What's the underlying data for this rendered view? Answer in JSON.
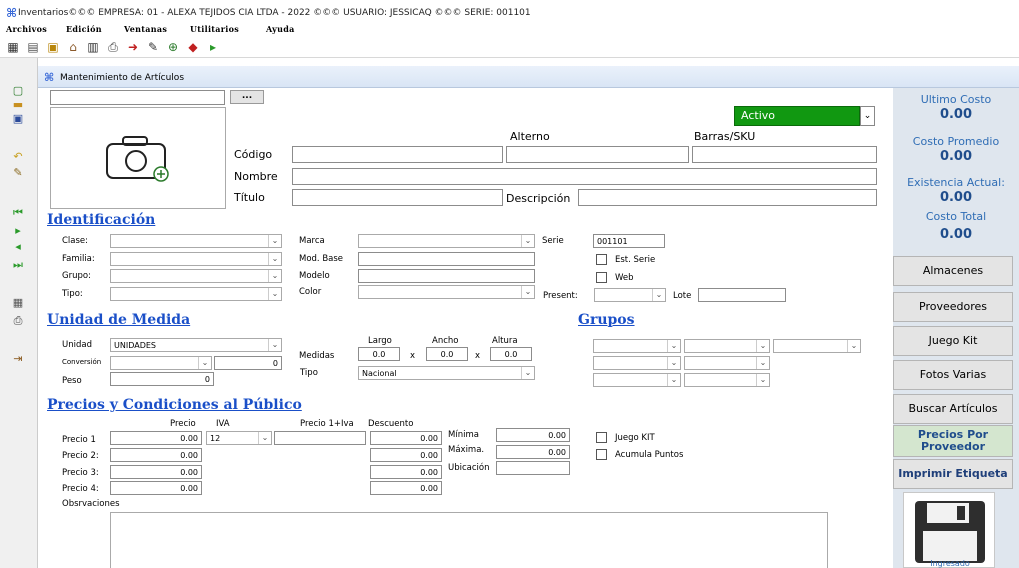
{
  "app": {
    "title": "Inventarios©©© EMPRESA: 01 - ALEXA TEJIDOS CIA LTDA - 2022 ©©©  USUARIO: JESSICAQ ©©© SERIE: 001101"
  },
  "menu": [
    "Archivos",
    "Edición",
    "Ventanas",
    "Utilitarios",
    "Ayuda"
  ],
  "window": {
    "title": "Mantenimiento de Artículos"
  },
  "header": {
    "ellipsis": "...",
    "status": "Activo",
    "alterno_label": "Alterno",
    "barras_label": "Barras/SKU",
    "codigo_label": "Código",
    "nombre_label": "Nombre",
    "titulo_label": "Título",
    "descripcion_label": "Descripción"
  },
  "identificacion": {
    "title": "Identificación",
    "clase": "Clase:",
    "familia": "Familia:",
    "grupo": "Grupo:",
    "tipo": "Tipo:",
    "marca": "Marca",
    "mod_base": "Mod. Base",
    "modelo": "Modelo",
    "color": "Color",
    "serie_label": "Serie",
    "serie_value": "001101",
    "est_serie": "Est. Serie",
    "web": "Web",
    "present": "Present:",
    "lote": "Lote"
  },
  "unidad": {
    "title": "Unidad de Medida",
    "unidad_label": "Unidad",
    "unidad_value": "UNIDADES",
    "conversion_label": "Conversión",
    "conversion_value": "0",
    "peso_label": "Peso",
    "peso_value": "0",
    "medidas_label": "Medidas",
    "largo": "Largo",
    "ancho": "Ancho",
    "altura": "Altura",
    "largo_value": "0.0",
    "ancho_value": "0.0",
    "altura_value": "0.0",
    "x": "x",
    "tipo_label": "Tipo",
    "tipo_value": "Nacional"
  },
  "grupos": {
    "title": "Grupos"
  },
  "precios": {
    "title": "Precios y Condiciones al Público",
    "col_precio": "Precio",
    "col_iva": "IVA",
    "col_precio_iva": "Precio 1+Iva",
    "col_descuento": "Descuento",
    "rows": [
      {
        "label": "Precio 1",
        "value": "0.00",
        "descuento": "0.00"
      },
      {
        "label": "Precio 2:",
        "value": "0.00",
        "descuento": "0.00"
      },
      {
        "label": "Precio 3:",
        "value": "0.00",
        "descuento": "0.00"
      },
      {
        "label": "Precio 4:",
        "value": "0.00",
        "descuento": "0.00"
      }
    ],
    "iva_value": "12",
    "minima_label": "Mínima",
    "minima_value": "0.00",
    "maxima_label": "Máxima.",
    "maxima_value": "0.00",
    "ubicacion_label": "Ubicación",
    "juego_kit": "Juego KIT",
    "acumula_puntos": "Acumula Puntos",
    "observaciones": "Obsrvaciones"
  },
  "right_panel": {
    "ultimo_costo_label": "Ultimo Costo",
    "ultimo_costo_value": "0.00",
    "costo_promedio_label": "Costo Promedio",
    "costo_promedio_value": "0.00",
    "existencia_label": "Existencia Actual:",
    "existencia_value": "0.00",
    "costo_total_label": "Costo Total",
    "costo_total_value": "0.00",
    "buttons": [
      "Almacenes",
      "Proveedores",
      "Juego Kit",
      "Fotos Varias",
      "Buscar Artículos"
    ],
    "precios_proveedor": "Precios Por Proveedor",
    "imprimir_etiqueta": "Imprimir Etiqueta",
    "save_caption": "Ingresado"
  },
  "colors": {
    "status_green": "#119811",
    "section_blue": "#1a4fc8",
    "panel_bg": "#dfe6ee"
  }
}
